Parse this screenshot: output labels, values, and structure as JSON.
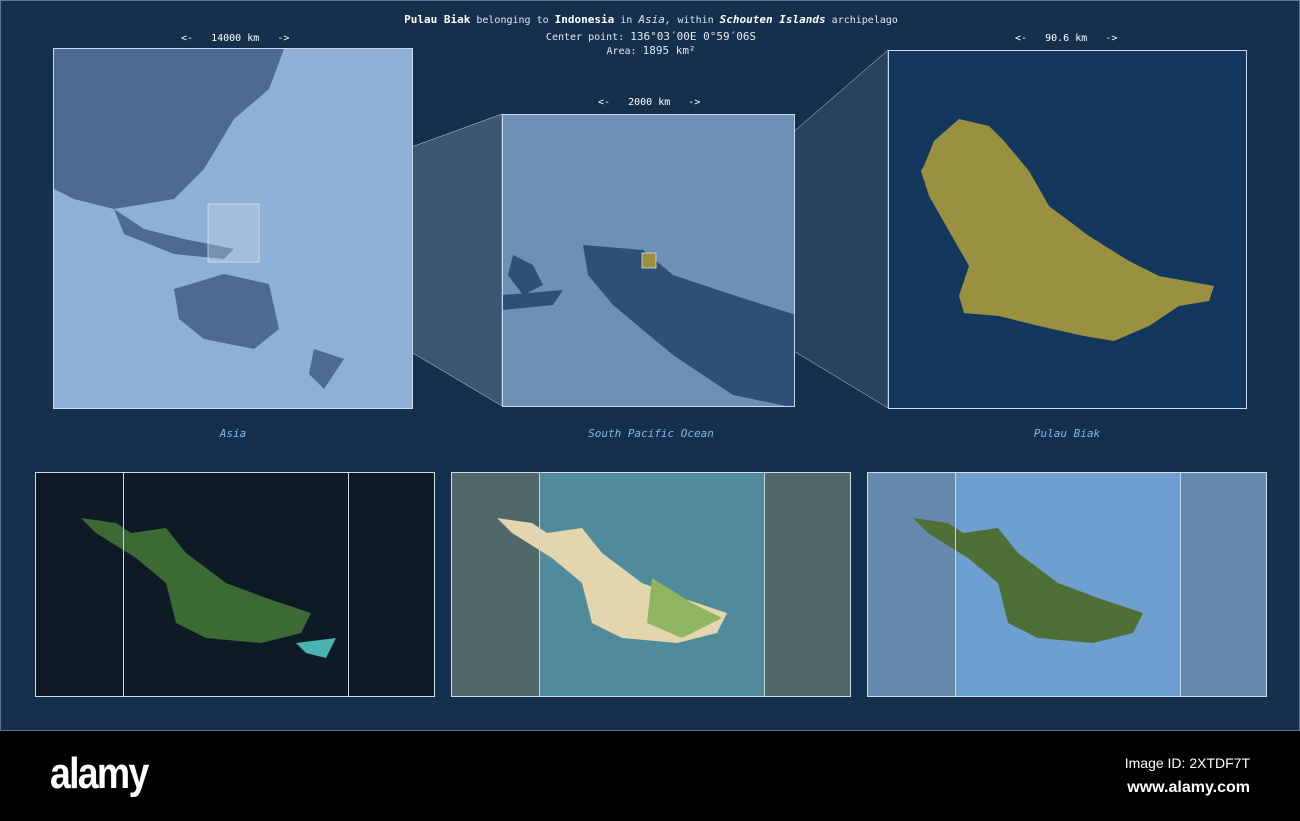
{
  "header": {
    "name": "Pulau Biak",
    "t1": "belonging to",
    "country": "Indonesia",
    "t2": "in",
    "continent": "Asia,",
    "t3": "within",
    "archipelago": "Schouten Islands",
    "t4": "archipelago",
    "center_label": "Center point:",
    "center_value": "136°03´00E  0°59´06S",
    "area_label": "Area:",
    "area_value": "1895 km²"
  },
  "scales": [
    "<-   14000 km   ->",
    "<-   2000 km   ->",
    "<-   90.6 km   ->"
  ],
  "captions": [
    "Asia",
    "South Pacific Ocean",
    "Pulau Biak"
  ],
  "colors": {
    "background": "#15304d",
    "island": "#9a9140",
    "caption": "#7fb8e8"
  },
  "footer": {
    "logo": "alamy",
    "image_id": "Image ID: 2XTDF7T",
    "url": "www.alamy.com"
  }
}
